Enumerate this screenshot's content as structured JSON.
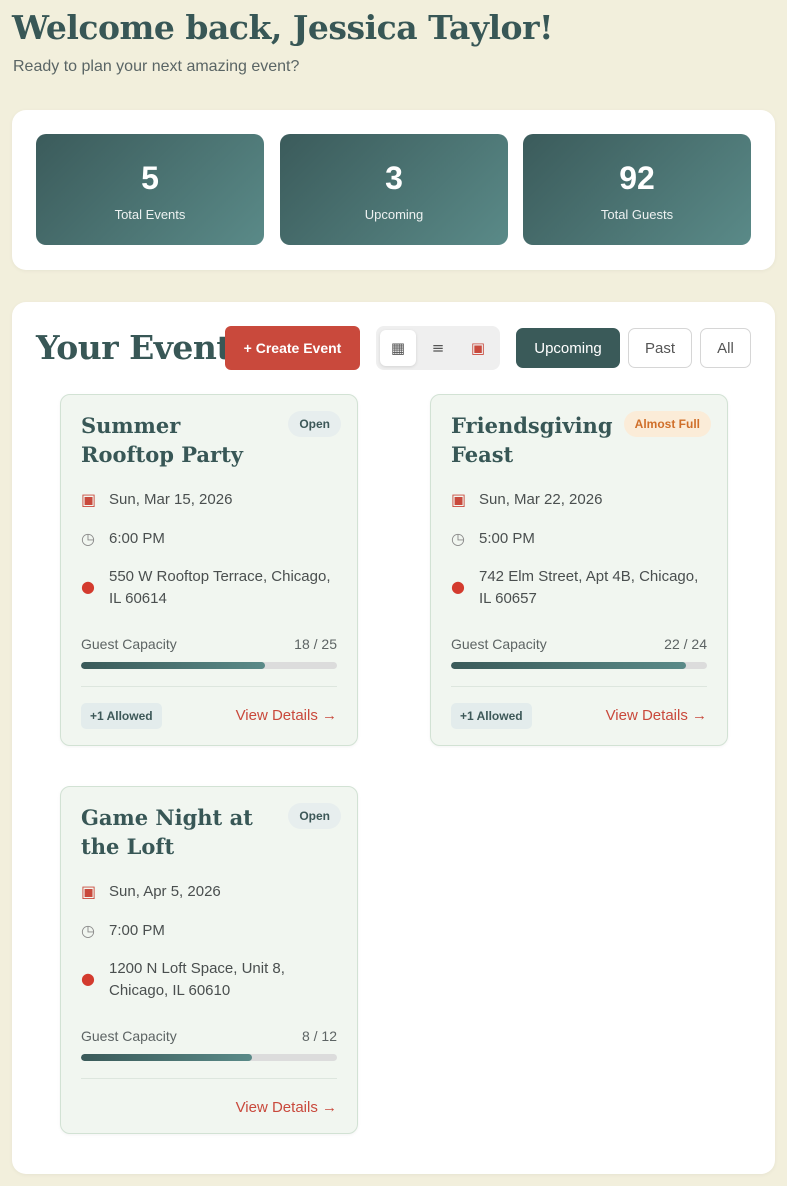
{
  "header": {
    "title": "Welcome back, Jessica Taylor!",
    "subtitle": "Ready to plan your next amazing event?"
  },
  "stats": [
    {
      "value": "5",
      "label": "Total Events"
    },
    {
      "value": "3",
      "label": "Upcoming"
    },
    {
      "value": "92",
      "label": "Total Guests"
    }
  ],
  "events_section": {
    "title": "Your Events",
    "create_label": "+ Create Event",
    "views": [
      {
        "icon": "grid-icon",
        "glyph": "▦"
      },
      {
        "icon": "list-icon",
        "glyph": "≡"
      },
      {
        "icon": "calendar-icon",
        "glyph": "▣"
      }
    ],
    "filters": [
      "Upcoming",
      "Past",
      "All"
    ],
    "capacity_label": "Guest Capacity",
    "view_details_label": "View Details →"
  },
  "events": [
    {
      "title": "Summer Rooftop Party",
      "status": "Open",
      "date": "Sun, Mar 15, 2026",
      "time": "6:00 PM",
      "location": "550 W Rooftop Terrace, Chicago, IL 60614",
      "capacity": "18 / 25",
      "capacity_fraction": 0.72,
      "plus_one": "+1 Allowed"
    },
    {
      "title": "Friendsgiving Feast",
      "status": "Almost Full",
      "date": "Sun, Mar 22, 2026",
      "time": "5:00 PM",
      "location": "742 Elm Street, Apt 4B, Chicago, IL 60657",
      "capacity": "22 / 24",
      "capacity_fraction": 0.917,
      "plus_one": "+1 Allowed"
    },
    {
      "title": "Game Night at the Loft",
      "status": "Open",
      "date": "Sun, Apr 5, 2026",
      "time": "7:00 PM",
      "location": "1200 N Loft Space, Unit 8, Chicago, IL 60610",
      "capacity": "8 / 12",
      "capacity_fraction": 0.667,
      "plus_one": ""
    }
  ],
  "colors": {
    "primary": "#3a5a59",
    "accent": "#c9493c",
    "background": "#f2efdc",
    "card": "#f1f6f0"
  }
}
